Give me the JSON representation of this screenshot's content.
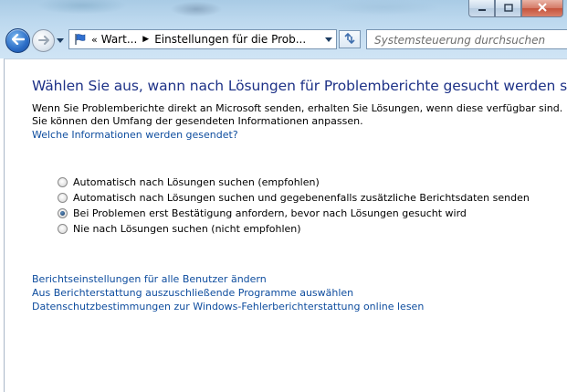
{
  "window": {
    "minimize_icon": "minimize-icon",
    "maximize_icon": "maximize-icon",
    "close_icon": "close-icon"
  },
  "navigation": {
    "back_icon": "back-arrow-icon",
    "forward_icon": "forward-arrow-icon",
    "address": {
      "overflow_chevron": "«",
      "breadcrumbs": [
        "Wart...",
        "Einstellungen für die Prob..."
      ]
    },
    "search_placeholder": "Systemsteuerung durchsuchen"
  },
  "page": {
    "heading": "Wählen Sie aus, wann nach Lösungen für Problemberichte gesucht werden soll.",
    "description": "Wenn Sie Problemberichte direkt an Microsoft senden, erhalten Sie Lösungen, wenn diese verfügbar sind. Sie können den Umfang der gesendeten Informationen anpassen.",
    "info_link": "Welche Informationen werden gesendet?",
    "options": [
      {
        "label": "Automatisch nach Lösungen suchen (empfohlen)",
        "checked": false
      },
      {
        "label": "Automatisch nach Lösungen suchen und gegebenenfalls zusätzliche Berichtsdaten senden",
        "checked": false
      },
      {
        "label": "Bei Problemen erst Bestätigung anfordern, bevor nach Lösungen gesucht wird",
        "checked": true
      },
      {
        "label": "Nie nach Lösungen suchen (nicht empfohlen)",
        "checked": false
      }
    ],
    "links": [
      "Berichtseinstellungen für alle Benutzer ändern",
      "Aus Berichterstattung auszuschließende Programme auswählen",
      "Datenschutzbestimmungen zur Windows-Fehlerberichterstattung online lesen"
    ]
  },
  "colors": {
    "heading": "#1e3287",
    "link": "#0d4c9e",
    "chrome": "#c9e0f3"
  }
}
